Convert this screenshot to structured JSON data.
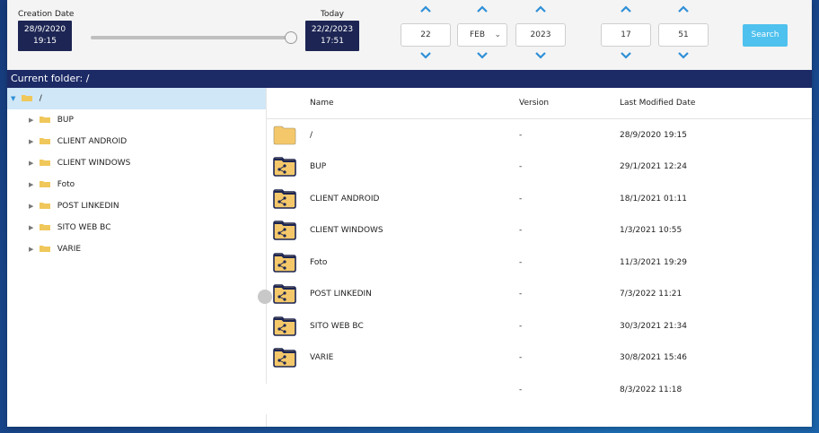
{
  "top": {
    "creation_caption": "Creation Date",
    "creation_date": "28/9/2020",
    "creation_time": "19:15",
    "today_caption": "Today",
    "today_date": "22/2/2023",
    "today_time": "17:51",
    "day": "22",
    "month": "FEB",
    "year": "2023",
    "hour": "17",
    "minute": "51",
    "search_label": "Search"
  },
  "current_folder": "Current folder: /",
  "tree": {
    "root": "/",
    "items": [
      "BUP",
      "CLIENT ANDROID",
      "CLIENT WINDOWS",
      "Foto",
      "POST LINKEDIN",
      "SITO WEB BC",
      "VARIE"
    ]
  },
  "table": {
    "columns": [
      "Name",
      "Version",
      "Last Modified Date"
    ],
    "rows": [
      {
        "name": "/",
        "version": "-",
        "date": "28/9/2020 19:15",
        "icon": "folder-icon"
      },
      {
        "name": "BUP",
        "version": "-",
        "date": "29/1/2021 12:24",
        "icon": "shared-folder-icon"
      },
      {
        "name": "CLIENT ANDROID",
        "version": "-",
        "date": "18/1/2021 01:11",
        "icon": "shared-folder-icon"
      },
      {
        "name": "CLIENT WINDOWS",
        "version": "-",
        "date": "1/3/2021 10:55",
        "icon": "shared-folder-icon"
      },
      {
        "name": "Foto",
        "version": "-",
        "date": "11/3/2021 19:29",
        "icon": "shared-folder-icon"
      },
      {
        "name": "POST LINKEDIN",
        "version": "-",
        "date": "7/3/2022 11:21",
        "icon": "shared-folder-icon"
      },
      {
        "name": "SITO WEB BC",
        "version": "-",
        "date": "30/3/2021 21:34",
        "icon": "shared-folder-icon"
      },
      {
        "name": "VARIE",
        "version": "-",
        "date": "30/8/2021 15:46",
        "icon": "shared-folder-icon"
      },
      {
        "name": "",
        "version": "-",
        "date": "8/3/2022 11:18",
        "icon": ""
      }
    ]
  },
  "colors": {
    "navy": "#1c2553",
    "accent": "#2e8fd6",
    "search": "#4fc1ee",
    "folder": "#f4c86a",
    "selection": "#cfe7f7"
  }
}
